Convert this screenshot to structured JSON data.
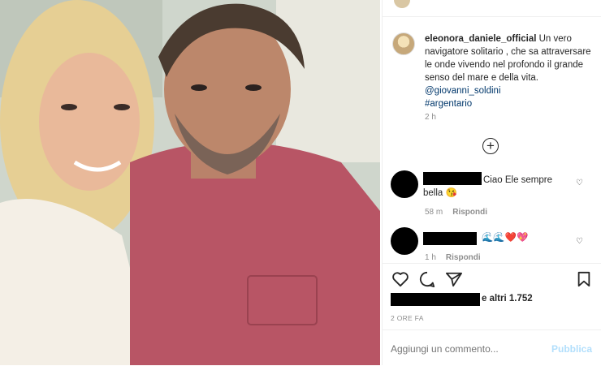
{
  "post": {
    "username": "eleonora_daniele_official",
    "caption_text": " Un vero navigatore solitario , che sa attraversare le onde vivendo nel profondo il grande senso del mare e della vita. ",
    "mention": "@giovanni_soldini",
    "hashtag": "#argentario",
    "time_ago": "2 h"
  },
  "comments": [
    {
      "text": "Ciao Ele sempre bella 😘",
      "time": "58 m",
      "reply_label": "Rispondi"
    },
    {
      "text": "🌊🌊❤️💖",
      "time": "1 h",
      "reply_label": "Rispondi"
    }
  ],
  "likes": {
    "text": "e altri 1.752"
  },
  "post_time": "2 ORE FA",
  "add_comment": {
    "placeholder": "Aggiungi un commento...",
    "publish_label": "Pubblica"
  },
  "icons": [
    "heart-icon",
    "comment-icon",
    "share-icon",
    "bookmark-icon",
    "plus-circle-icon"
  ]
}
